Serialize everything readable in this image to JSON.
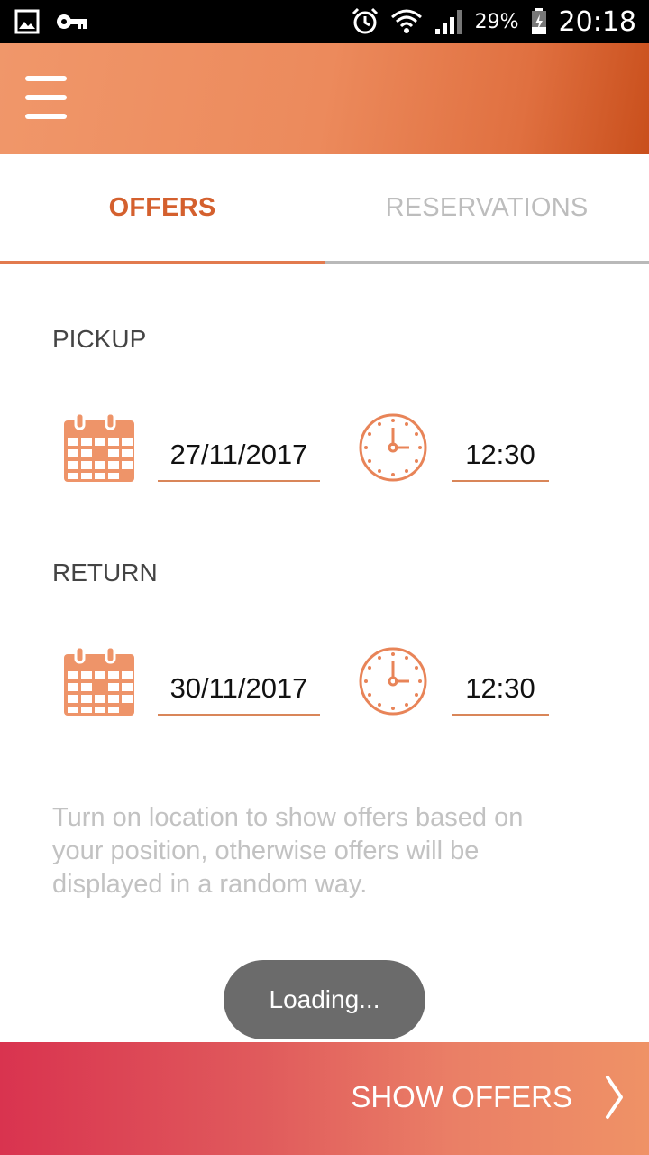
{
  "status_bar": {
    "battery": "29%",
    "time": "20:18"
  },
  "tabs": [
    {
      "label": "OFFERS",
      "active": true
    },
    {
      "label": "RESERVATIONS",
      "active": false
    }
  ],
  "pickup": {
    "label": "PICKUP",
    "date": "27/11/2017",
    "time": "12:30"
  },
  "return": {
    "label": "RETURN",
    "date": "30/11/2017",
    "time": "12:30"
  },
  "info_text": "Turn on location to show offers based on your position, otherwise offers will be displayed in a random way.",
  "toast": "Loading...",
  "bottom_button": {
    "label": "SHOW OFFERS"
  },
  "colors": {
    "accent": "#d4602e",
    "icon": "#ee9469",
    "field_underline": "#d98659"
  },
  "icons": [
    "gallery-icon",
    "key-icon",
    "alarm-icon",
    "wifi-icon",
    "signal-icon",
    "battery-icon",
    "menu-icon",
    "calendar-icon",
    "clock-icon",
    "chevron-right-icon"
  ]
}
